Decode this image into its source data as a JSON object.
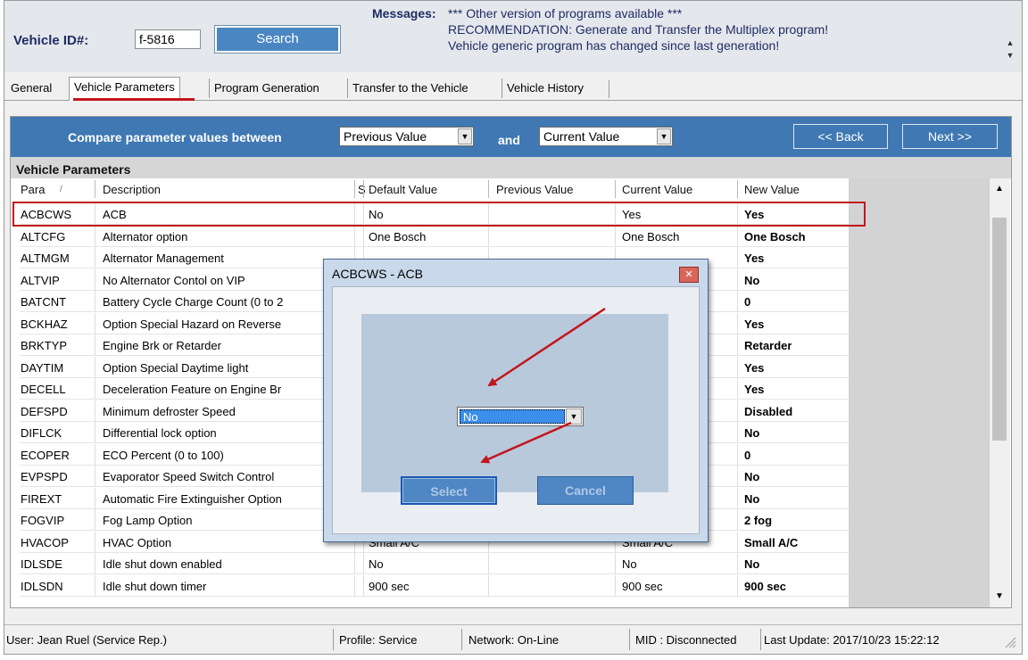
{
  "header": {
    "vehicle_id_label": "Vehicle ID#:",
    "vehicle_id_value": "f-5816",
    "search_label": "Search",
    "messages_label": "Messages:",
    "messages": [
      "*** Other version of programs available ***",
      "RECOMMENDATION: Generate and Transfer the Multiplex program!",
      "Vehicle generic program has changed since last generation!"
    ]
  },
  "tabs": [
    "General",
    "Vehicle Parameters",
    "Program Generation",
    "Transfer to the Vehicle",
    "Vehicle History"
  ],
  "compare": {
    "label": "Compare parameter values between",
    "from": "Previous Value",
    "and_label": "and",
    "to": "Current Value",
    "back_label": "<< Back",
    "next_label": "Next >>"
  },
  "section_title": "Vehicle Parameters",
  "columns": [
    "Para",
    "Description",
    "S",
    "Default Value",
    "Previous Value",
    "Current Value",
    "New Value"
  ],
  "rows": [
    {
      "para": "ACBCWS",
      "desc": "ACB",
      "default": "No",
      "previous": "",
      "current": "Yes",
      "new": "Yes"
    },
    {
      "para": "ALTCFG",
      "desc": "Alternator option",
      "default": "One Bosch",
      "previous": "",
      "current": "One Bosch",
      "new": "One Bosch"
    },
    {
      "para": "ALTMGM",
      "desc": "Alternator Management",
      "default": "",
      "previous": "",
      "current": "",
      "new": "Yes"
    },
    {
      "para": "ALTVIP",
      "desc": "No Alternator Contol on VIP",
      "default": "",
      "previous": "",
      "current": "",
      "new": "No"
    },
    {
      "para": "BATCNT",
      "desc": "Battery Cycle Charge Count (0 to 2",
      "default": "",
      "previous": "",
      "current": "",
      "new": "0"
    },
    {
      "para": "BCKHAZ",
      "desc": "Option Special Hazard on Reverse",
      "default": "",
      "previous": "",
      "current": "",
      "new": "Yes"
    },
    {
      "para": "BRKTYP",
      "desc": "Engine Brk or Retarder",
      "default": "",
      "previous": "",
      "current": "",
      "new": "Retarder"
    },
    {
      "para": "DAYTIM",
      "desc": "Option Special Daytime light",
      "default": "",
      "previous": "",
      "current": "",
      "new": "Yes"
    },
    {
      "para": "DECELL",
      "desc": "Deceleration Feature on Engine Br",
      "default": "",
      "previous": "",
      "current": "",
      "new": "Yes"
    },
    {
      "para": "DEFSPD",
      "desc": "Minimum defroster Speed",
      "default": "",
      "previous": "",
      "current": "",
      "new": "Disabled"
    },
    {
      "para": "DIFLCK",
      "desc": "Differential lock option",
      "default": "",
      "previous": "",
      "current": "",
      "new": "No"
    },
    {
      "para": "ECOPER",
      "desc": "ECO Percent (0 to 100)",
      "default": "",
      "previous": "",
      "current": "",
      "new": "0"
    },
    {
      "para": "EVPSPD",
      "desc": "Evaporator Speed Switch Control",
      "default": "",
      "previous": "",
      "current": "",
      "new": "No"
    },
    {
      "para": "FIREXT",
      "desc": "Automatic Fire Extinguisher Option",
      "default": "",
      "previous": "",
      "current": "",
      "new": "No"
    },
    {
      "para": "FOGVIP",
      "desc": "Fog Lamp Option",
      "default": "",
      "previous": "",
      "current": "",
      "new": "2 fog"
    },
    {
      "para": "HVACOP",
      "desc": "HVAC Option",
      "default": "Small A/C",
      "previous": "",
      "current": "Small A/C",
      "new": "Small A/C"
    },
    {
      "para": "IDLSDE",
      "desc": "Idle shut down enabled",
      "default": "No",
      "previous": "",
      "current": "No",
      "new": "No"
    },
    {
      "para": "IDLSDN",
      "desc": "Idle shut down timer",
      "default": "900 sec",
      "previous": "",
      "current": "900 sec",
      "new": "900 sec"
    }
  ],
  "dialog": {
    "title": "ACBCWS - ACB",
    "selected": "No",
    "select_label": "Select",
    "cancel_label": "Cancel"
  },
  "status": {
    "user": "User: Jean Ruel (Service Rep.)",
    "profile": "Profile: Service",
    "network": "Network: On-Line",
    "mid": "MID : Disconnected",
    "last_update": "Last Update: 2017/10/23 15:22:12"
  },
  "colors": {
    "accent_blue": "#3f78b2",
    "highlight_red": "#c2161c",
    "header_text": "#1f2b64"
  }
}
